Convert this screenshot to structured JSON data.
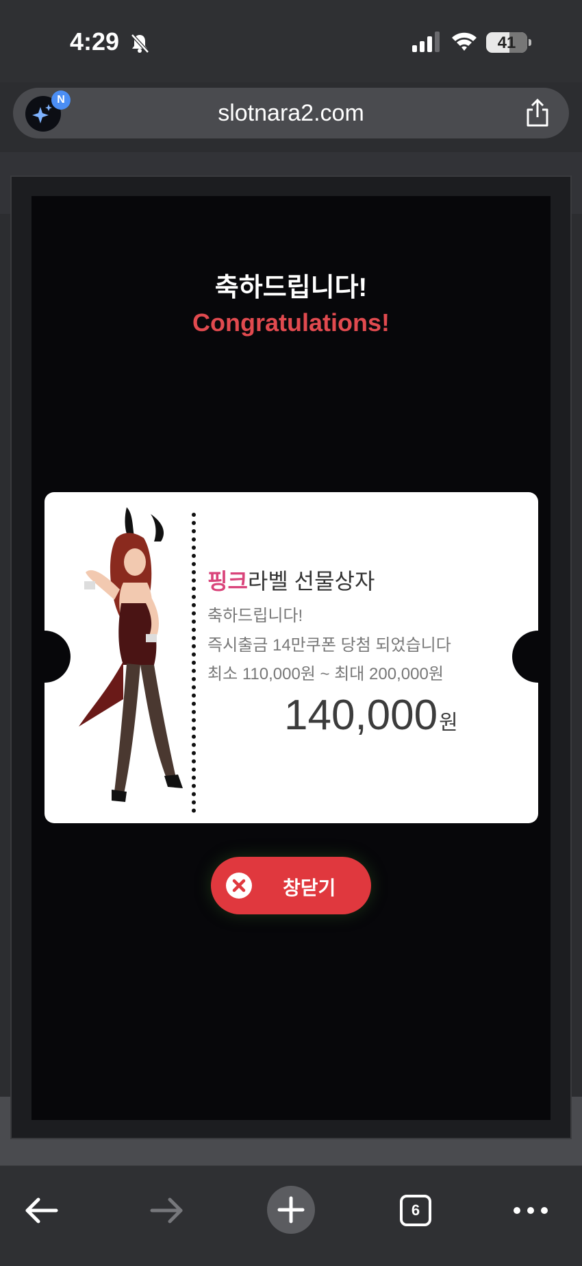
{
  "status_bar": {
    "time": "4:29",
    "battery": "41"
  },
  "browser": {
    "url": "slotnara2.com",
    "avatar_badge": "N",
    "tab_count": "6"
  },
  "popup": {
    "title_kr": "축하드립니다!",
    "title_en": "Congratulations!",
    "coupon": {
      "title_accent": "핑크",
      "title_rest": "라벨 선물상자",
      "line1": "축하드립니다!",
      "line2": "즉시출금 14만쿠폰 당첨 되었습니다",
      "line3": "최소 110,000원 ~ 최대 200,000원",
      "amount": "140,000",
      "amount_unit": "원"
    },
    "close_label": "창닫기"
  },
  "colors": {
    "accent_red": "#e0383e",
    "title_red": "#e14a4f",
    "pink_accent": "#d9447a"
  }
}
